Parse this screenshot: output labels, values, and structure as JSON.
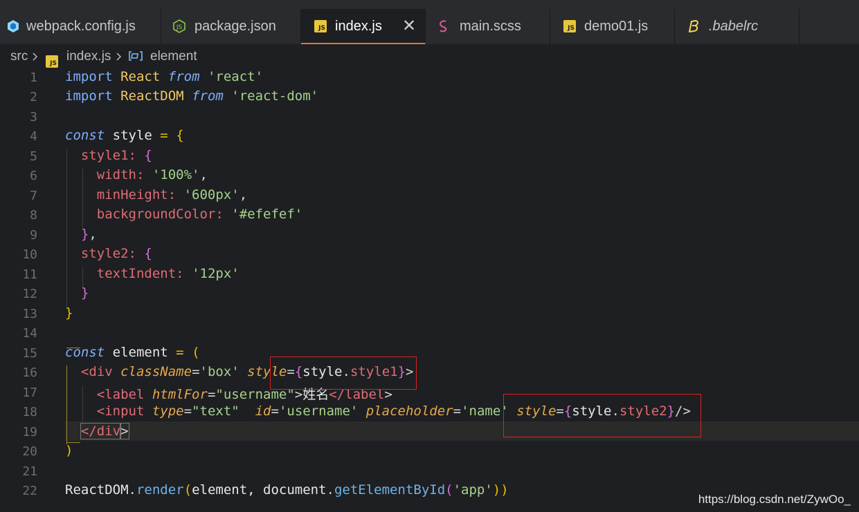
{
  "tabs": [
    {
      "label": "webpack.config.js",
      "icon": "webpack-icon"
    },
    {
      "label": "package.json",
      "icon": "nodejs-icon"
    },
    {
      "label": "index.js",
      "icon": "js-file-icon",
      "active": true
    },
    {
      "label": "main.scss",
      "icon": "sass-icon"
    },
    {
      "label": "demo01.js",
      "icon": "js-file-icon"
    },
    {
      "label": ".babelrc",
      "icon": "babel-icon"
    }
  ],
  "js_badge": "JS",
  "close_glyph": "✕",
  "breadcrumb": {
    "folder": "src",
    "file": "index.js",
    "symbol": "element"
  },
  "line_numbers": [
    "1",
    "2",
    "3",
    "4",
    "5",
    "6",
    "7",
    "8",
    "9",
    "10",
    "11",
    "12",
    "13",
    "14",
    "15",
    "16",
    "17",
    "18",
    "19",
    "20",
    "21",
    "22"
  ],
  "code": {
    "l1": [
      "import",
      " ",
      "React",
      " ",
      "from",
      " ",
      "'react'"
    ],
    "l2": [
      "import",
      " ",
      "ReactDOM",
      " ",
      "from",
      " ",
      "'react-dom'"
    ],
    "l4": [
      "const",
      " style ",
      "=",
      " ",
      "{"
    ],
    "l5": [
      "  ",
      "style1:",
      " ",
      "{"
    ],
    "l6": [
      "    ",
      "width:",
      " ",
      "'100%'",
      ","
    ],
    "l7": [
      "    ",
      "minHeight:",
      " ",
      "'600px'",
      ","
    ],
    "l8": [
      "    ",
      "backgroundColor:",
      " ",
      "'#efefef'"
    ],
    "l9": [
      "  ",
      "}",
      ","
    ],
    "l10": [
      "  ",
      "style2:",
      " ",
      "{"
    ],
    "l11": [
      "    ",
      "textIndent:",
      " ",
      "'12px'"
    ],
    "l12": [
      "  ",
      "}"
    ],
    "l13": [
      "}"
    ],
    "l15": [
      "const",
      " element ",
      "=",
      " ",
      "("
    ],
    "l16": [
      "  ",
      "<div",
      " ",
      "className",
      "=",
      "'box'",
      " ",
      "style",
      "=",
      "{",
      "style",
      ".",
      "style1",
      "}",
      ">"
    ],
    "l17": [
      "    ",
      "<label",
      " ",
      "htmlFor",
      "=",
      "\"username\"",
      ">",
      "姓名",
      "</label",
      ">"
    ],
    "l18": [
      "    ",
      "<input",
      " ",
      "type",
      "=",
      "\"text\"",
      "  ",
      "id",
      "=",
      "'username'",
      " ",
      "placeholder",
      "=",
      "'name'",
      " ",
      "style",
      "=",
      "{",
      "style",
      ".",
      "style2",
      "}",
      "/>"
    ],
    "l19": [
      "  ",
      "</div",
      ">"
    ],
    "l20": [
      ")"
    ],
    "l22": [
      "ReactDOM",
      ".",
      "render",
      "(",
      "element, document",
      ".",
      "getElementById",
      "(",
      "'app'",
      "))"
    ]
  },
  "watermark": "https://blog.csdn.net/ZywOo_"
}
